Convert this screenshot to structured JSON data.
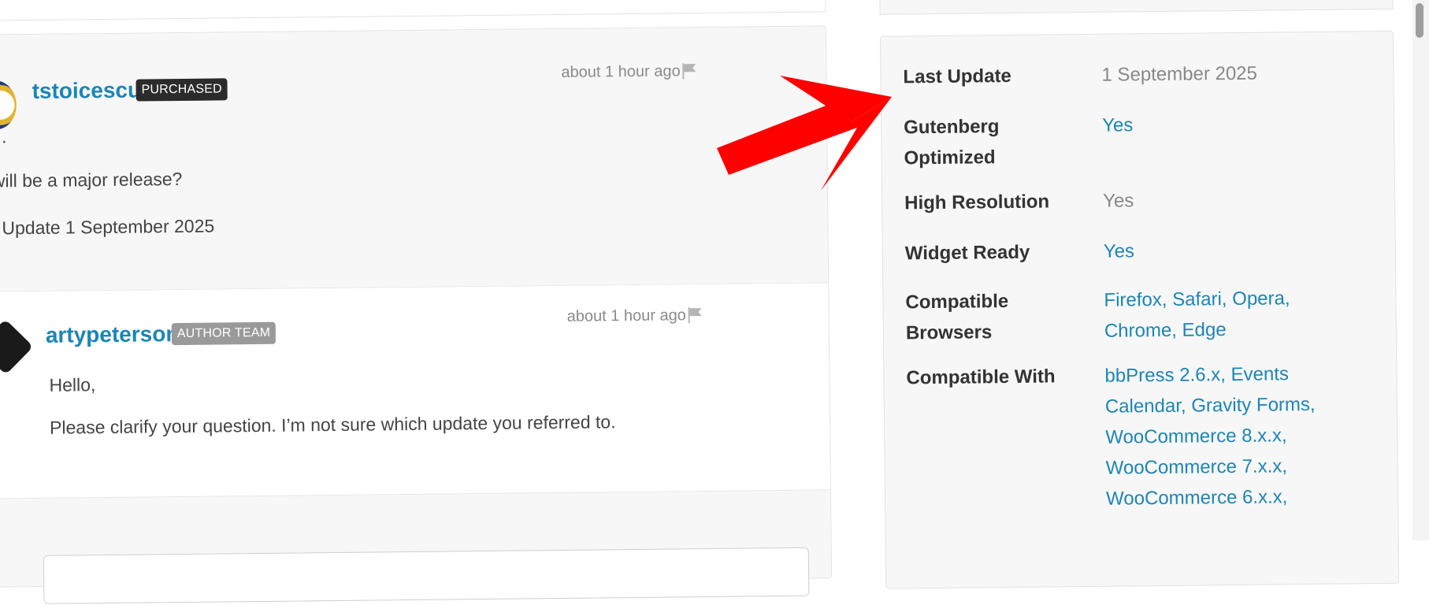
{
  "comments": [
    {
      "username": "tstoicescu",
      "badge": "PURCHASED",
      "time": "about 1 hour ago",
      "lines": [
        "r..",
        "will be a major release?",
        "Update 1 September 2025"
      ]
    },
    {
      "username": "artypeterson",
      "badge": "AUTHOR TEAM",
      "time": "about 1 hour ago",
      "lines": [
        "Hello,",
        "Please clarify your question. I’m not sure which update you referred to."
      ]
    }
  ],
  "details": {
    "last_update": {
      "label": "Last Update",
      "value": "1 September 2025"
    },
    "gutenberg": {
      "label_line1": "Gutenberg",
      "label_line2": "Optimized",
      "value": "Yes"
    },
    "high_res": {
      "label": "High Resolution",
      "value": "Yes"
    },
    "widget_ready": {
      "label": "Widget Ready",
      "value": "Yes"
    },
    "browsers": {
      "label_line1": "Compatible",
      "label_line2": "Browsers",
      "values": [
        "Firefox",
        "Safari",
        "Opera",
        "Chrome",
        "Edge"
      ]
    },
    "compatible_with": {
      "label": "Compatible With",
      "values": [
        "bbPress 2.6.x",
        "Events Calendar",
        "Gravity Forms",
        "WooCommerce 8.x.x",
        "WooCommerce 7.x.x",
        "WooCommerce 6.x.x"
      ]
    },
    "separator": ","
  },
  "colors": {
    "link": "#1b86b6",
    "arrow": "#ff0000",
    "badge_dark": "#2b2b2b",
    "badge_gray": "#9a9a9a"
  },
  "icons": [
    "flag-icon",
    "red-arrow-annotation"
  ]
}
